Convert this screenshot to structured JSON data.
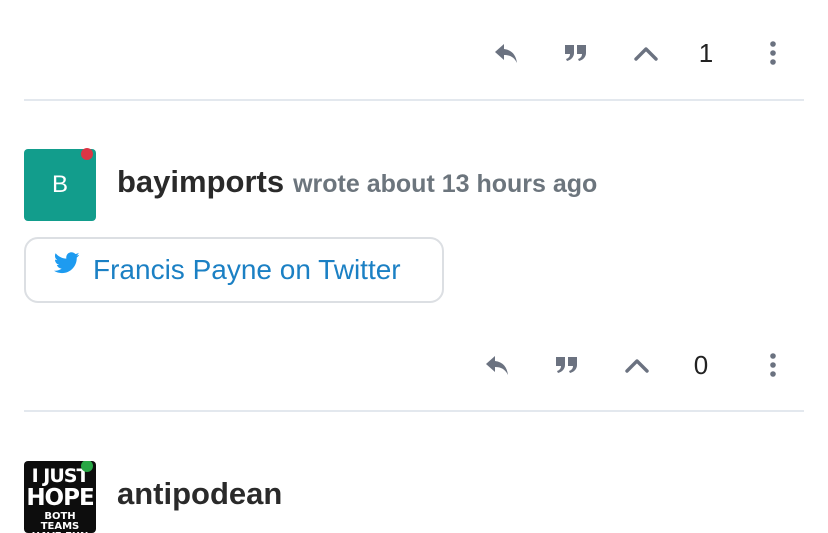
{
  "post_1": {
    "vote_count": "1"
  },
  "post_2": {
    "avatar_letter": "B",
    "username": "bayimports",
    "timestamp": "wrote about 13 hours ago",
    "onebox_label": "Francis Payne on Twitter",
    "vote_count": "0"
  },
  "post_3": {
    "username": "antipodean",
    "avatar_text": [
      "I JUST",
      "HOPE",
      "BOTH TEAMS HAVE FUN"
    ]
  },
  "icons": {
    "reply": "reply-icon",
    "quote": "quote-icon",
    "upvote": "chevron-up-icon",
    "more": "more-vertical-icon",
    "twitter": "twitter-icon"
  },
  "colors": {
    "avatar_teal": "#129d8c",
    "presence_away": "#dc3545",
    "presence_online": "#28a745",
    "link_blue": "#1b80c4",
    "muted_text": "#6c757d",
    "action_icon": "#6b7280"
  }
}
